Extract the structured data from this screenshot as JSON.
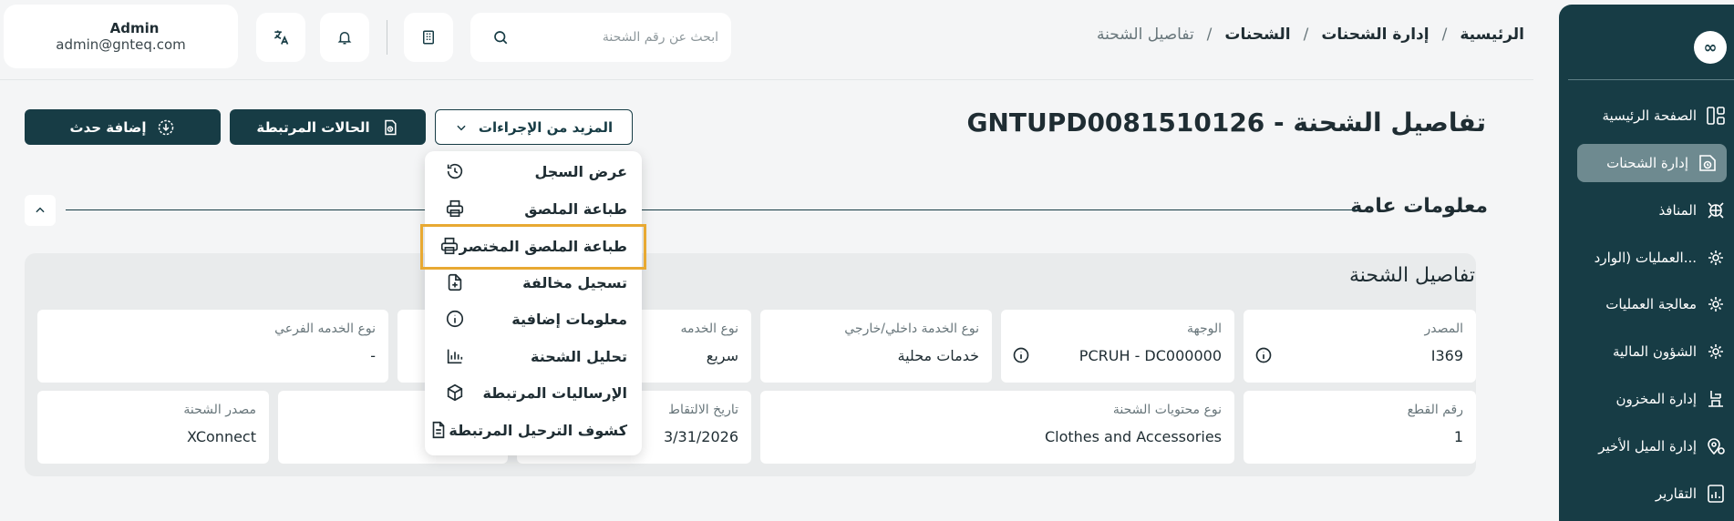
{
  "sidebar": {
    "logo": "∞",
    "items": [
      {
        "label": "الصفحة الرئيسية",
        "icon": "dashboard-icon"
      },
      {
        "label": "إدارة الشحنات",
        "icon": "package-icon",
        "active": true
      },
      {
        "label": "المنافذ",
        "icon": "ports-icon"
      },
      {
        "label": "العمليات (الوارد...",
        "icon": "gear-icon"
      },
      {
        "label": "معالجة العمليات",
        "icon": "gear-icon"
      },
      {
        "label": "الشؤون المالية",
        "icon": "gear-icon"
      },
      {
        "label": "إدارة المخزون",
        "icon": "warehouse-icon"
      },
      {
        "label": "إدارة الميل الأخير",
        "icon": "location-icon"
      },
      {
        "label": "التقارير",
        "icon": "report-icon"
      }
    ]
  },
  "header": {
    "breadcrumb": [
      "الرئيسية",
      "إدارة الشحنات",
      "الشحنات",
      "تفاصيل الشحنة"
    ],
    "search_placeholder": "ابحث عن رقم الشحنة",
    "user_name": "Admin",
    "user_email": "admin@gnteq.com"
  },
  "page": {
    "title": "تفاصيل الشحنة - GNTUPD0081510126",
    "more_actions": "المزيد من الإجراءات",
    "related_cases": "الحالات المرتبطة",
    "add_event": "إضافة حدث"
  },
  "section": {
    "title": "معلومات عامة",
    "panel_title": "تفاصيل الشحنة"
  },
  "fields": {
    "source_label": "المصدر",
    "source_value": "I369",
    "destination_label": "الوجهة",
    "destination_value": "PCRUH - DC000000",
    "service_scope_label": "نوع الخدمة داخلي/خارجي",
    "service_scope_value": "خدمات محلية",
    "service_type_label": "نوع الخدمه",
    "service_type_value": "سريع",
    "sub_service_label": "نوع الخدمه الفرعي",
    "sub_service_value": "-",
    "pieces_label": "رقم القطع",
    "pieces_value": "1",
    "contents_label": "نوع محتويات الشحنة",
    "contents_value": "Clothes and Accessories",
    "pickup_label": "تاريخ الالتقاط",
    "pickup_value": "3/31/2026",
    "origin_label": "مصدر الشحنة",
    "origin_value": "XConnect"
  },
  "menu": {
    "items": [
      {
        "label": "عرض السجل",
        "icon": "history-icon"
      },
      {
        "label": "طباعة الملصق",
        "icon": "printer-icon"
      },
      {
        "label": "طباعة الملصق المختصر",
        "icon": "printer-icon",
        "highlighted": true
      },
      {
        "label": "تسجيل مخالفة",
        "icon": "file-plus-icon"
      },
      {
        "label": "معلومات إضافية",
        "icon": "info-icon"
      },
      {
        "label": "تحليل الشحنة",
        "icon": "bar-chart-icon"
      },
      {
        "label": "الإرسالیات المرتبطة",
        "icon": "box-icon"
      },
      {
        "label": "كشوف الترحيل المرتبطة",
        "icon": "document-icon"
      }
    ]
  },
  "colors": {
    "primary": "#173c45",
    "highlight": "#e8a932",
    "background": "#f4f5f6"
  }
}
